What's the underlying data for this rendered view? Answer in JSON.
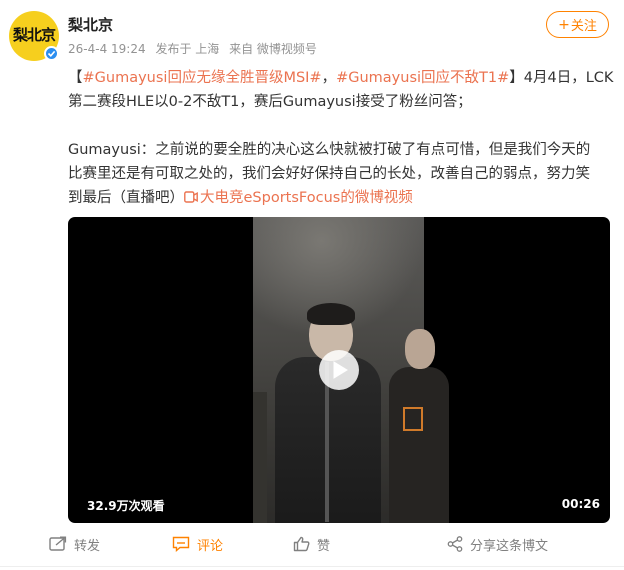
{
  "author": {
    "name": "梨北京",
    "avatar_text": "梨北京",
    "verified": true
  },
  "meta": {
    "time": "26-4-4 19:24",
    "location": "发布于 上海",
    "source": "来自 微博视频号"
  },
  "follow_button": {
    "plus": "+",
    "label": "关注"
  },
  "post": {
    "open_bracket": "【",
    "hashtag1": "#Gumayusi回应无缘全胜晋级MSI#",
    "comma": "，",
    "hashtag2": "#Gumayusi回应不敌T1#",
    "line1_rest": "】4月4日，LCK",
    "line2": "第二赛段HLE以0-2不敌T1，赛后Gumayusi接受了粉丝问答；",
    "line3": "Gumayusi：之前说的要全胜的决心这么快就被打破了有点可惜，但是我们今天的",
    "line4": "比赛里还是有可取之处的，我们会好好保持自己的长处，改善自己的弱点，努力笑",
    "line5_prefix": "到最后（直播吧）",
    "video_link": "大电竞eSportsFocus的微博视频"
  },
  "video": {
    "views": "32.9万次观看",
    "duration": "00:26"
  },
  "actions": {
    "repost": "转发",
    "comment": "评论",
    "like": "赞",
    "share": "分享这条博文"
  },
  "colors": {
    "accent": "#ff8200",
    "link": "#eb7350",
    "avatar_bg": "#f6cf1e",
    "verified": "#2b8ef0"
  },
  "icons": [
    "repost-icon",
    "comment-icon",
    "like-icon",
    "share-icon",
    "play-icon",
    "video-link-icon",
    "verified-icon"
  ]
}
